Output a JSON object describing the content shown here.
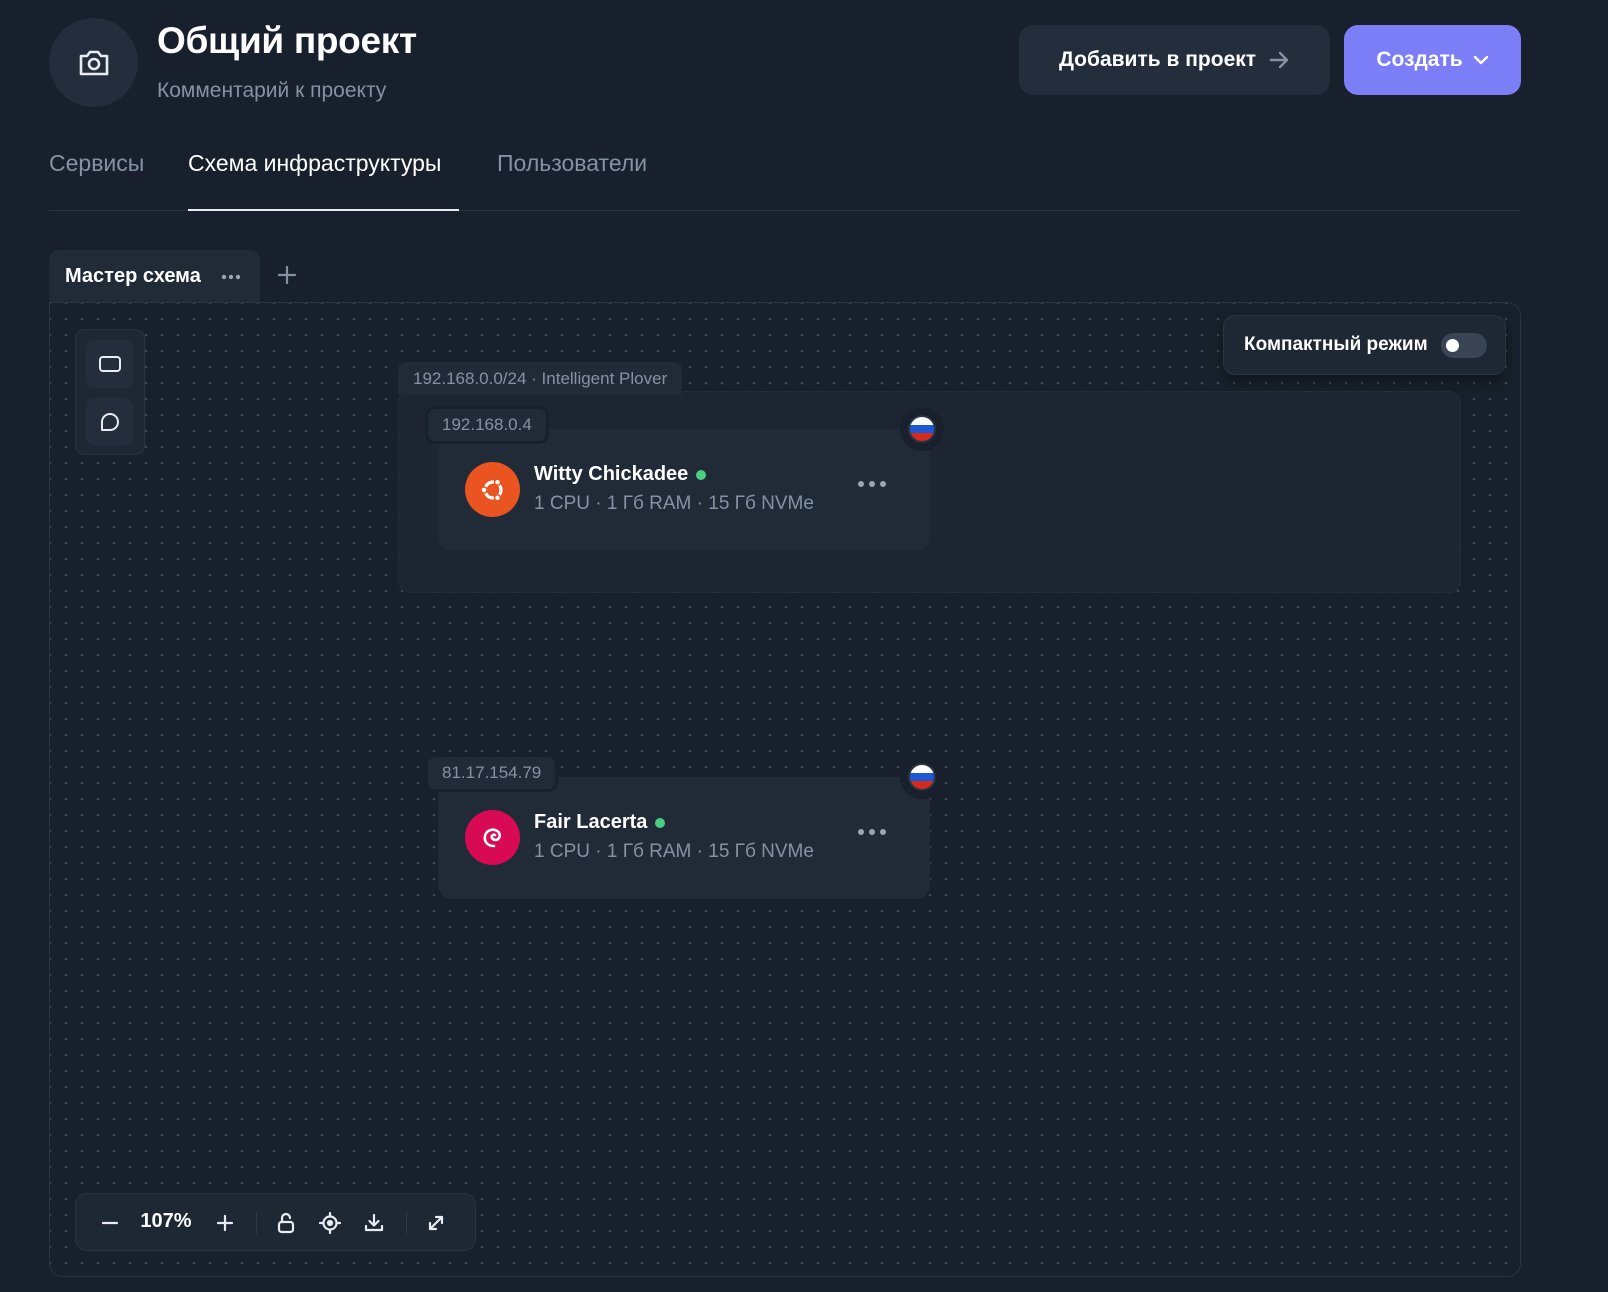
{
  "project": {
    "title": "Общий проект",
    "comment": "Комментарий к проекту",
    "avatar_icon": "camera-icon"
  },
  "header": {
    "add_to_project_label": "Добавить в проект",
    "create_label": "Создать",
    "accent_color": "#7b7ef7"
  },
  "tabs": [
    {
      "label": "Сервисы",
      "active": false
    },
    {
      "label": "Схема инфраструктуры",
      "active": true
    },
    {
      "label": "Пользователи",
      "active": false
    }
  ],
  "scheme": {
    "tab_label": "Мастер схема"
  },
  "canvas": {
    "compact_mode_label": "Компактный режим",
    "compact_mode_on": false,
    "network": {
      "label": "192.168.0.0/24 · Intelligent Plover"
    },
    "servers": [
      {
        "ip": "192.168.0.4",
        "name": "Witty Chickadee",
        "specs": "1 CPU · 1 Гб RAM · 15 Гб NVMe",
        "os_icon": "ubuntu-icon",
        "os_color": "#e95420",
        "status_color": "#4ccd84",
        "flag": "russia-flag-icon"
      },
      {
        "ip": "81.17.154.79",
        "name": "Fair Lacerta",
        "specs": "1 CPU · 1 Гб RAM · 15 Гб NVMe",
        "os_icon": "debian-icon",
        "os_color": "#d70a53",
        "status_color": "#4ccd84",
        "flag": "russia-flag-icon"
      }
    ],
    "zoom": "107%"
  }
}
